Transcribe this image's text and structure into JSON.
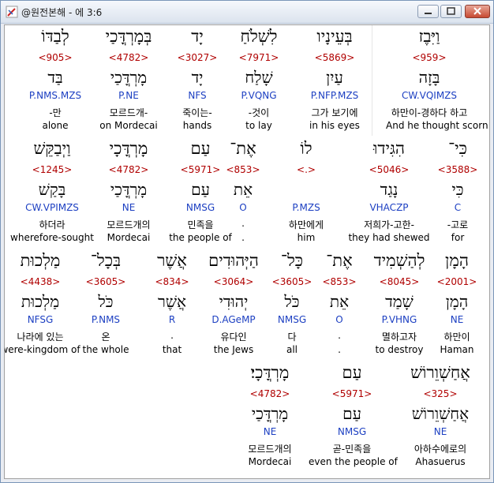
{
  "window": {
    "title": "@원전본해 - 에 3:6"
  },
  "rows": [
    [
      {
        "heb": "וַיִּבֶז",
        "strong": "<959>",
        "lemma": "בָּזָה",
        "morph": "CW.VQIMZS",
        "kor": "하만이-경하다 하고",
        "eng": "And he thought scorn",
        "selected": true
      },
      {
        "heb": "בְּעֵינָיו",
        "strong": "<5869>",
        "lemma": "עַיִן",
        "morph": "P.NFP.MZS",
        "kor": "그가 보기에",
        "eng": "in his eyes"
      },
      {
        "heb": "לִשְׁלֹחַ",
        "strong": "<7971>",
        "lemma": "שָׁלַח",
        "morph": "P.VQNG",
        "kor": "-것이",
        "eng": "to lay"
      },
      {
        "heb": "יָד",
        "strong": "<3027>",
        "lemma": "יָד",
        "morph": "NFS",
        "kor": "죽이는-",
        "eng": "hands"
      },
      {
        "heb": "בְּמָרְדֳּכַי",
        "strong": "<4782>",
        "lemma": "מָרְדֳּכַי",
        "morph": "P.NE",
        "kor": "모르드개-",
        "eng": "on Mordecai"
      },
      {
        "heb": "לְבַדּוֹ",
        "strong": "<905>",
        "lemma": "בַּד",
        "morph": "P.NMS.MZS",
        "kor": "-만",
        "eng": "alone"
      }
    ],
    [
      {
        "heb": "כִּי־",
        "strong": "<3588>",
        "lemma": "כִּי",
        "morph": "C",
        "kor": "-고로",
        "eng": "for"
      },
      {
        "heb": "הִגִּידוּ",
        "strong": "<5046>",
        "lemma": "נָגַד",
        "morph": "VHACZP",
        "kor": "저희가-고한-",
        "eng": "they had shewed"
      },
      {
        "heb": "לוֹ",
        "strong": "<.>",
        "lemma": "",
        "morph": "P.MZS",
        "kor": "하만에게",
        "eng": "him"
      },
      {
        "heb": "אֶת־",
        "strong": "<853>",
        "lemma": "אֵת",
        "morph": "O",
        "kor": ".",
        "eng": "."
      },
      {
        "heb": "עַם",
        "strong": "<5971>",
        "lemma": "עַם",
        "morph": "NMSG",
        "kor": "민족을",
        "eng": "the people of"
      },
      {
        "heb": "מָרְדֳּכָי",
        "strong": "<4782>",
        "lemma": "מָרְדֳּכַי",
        "morph": "NE",
        "kor": "모르드개의",
        "eng": "Mordecai"
      },
      {
        "heb": "וַיְבַקֵּשׁ",
        "strong": "<1245>",
        "lemma": "בָּקַשׁ",
        "morph": "CW.VPIMZS",
        "kor": "하더라",
        "eng": "wherefore-sought"
      }
    ],
    [
      {
        "heb": "הָמָן",
        "strong": "<2001>",
        "lemma": "הָמָן",
        "morph": "NE",
        "kor": "하만이",
        "eng": "Haman"
      },
      {
        "heb": "לְהַשְׁמִיד",
        "strong": "<8045>",
        "lemma": "שָׁמַד",
        "morph": "P.VHNG",
        "kor": "멸하고자",
        "eng": "to destroy"
      },
      {
        "heb": "אֶת־",
        "strong": "<853>",
        "lemma": "אֵת",
        "morph": "O",
        "kor": ".",
        "eng": "."
      },
      {
        "heb": "כָּל־",
        "strong": "<3605>",
        "lemma": "כֹּל",
        "morph": "NMSG",
        "kor": "다",
        "eng": "all"
      },
      {
        "heb": "הַיְּהוּדִים",
        "strong": "<3064>",
        "lemma": "יְהוּדִי",
        "morph": "D.AGeMP",
        "kor": "유다인",
        "eng": "the Jews"
      },
      {
        "heb": "אֲשֶׁר",
        "strong": "<834>",
        "lemma": "אֲשֶׁר",
        "morph": "R",
        "kor": ".",
        "eng": "that"
      },
      {
        "heb": "בְּכָל־",
        "strong": "<3605>",
        "lemma": "כֹּל",
        "morph": "P.NMS",
        "kor": "온",
        "eng": "the whole"
      },
      {
        "heb": "מַלְכוּת",
        "strong": "<4438>",
        "lemma": "מַלְכוּת",
        "morph": "NFSG",
        "kor": "나라에 있는",
        "eng": "were-kingdom of"
      }
    ],
    [
      {
        "heb": "אֲחַשְׁוֵרוֹשׁ",
        "strong": "<325>",
        "lemma": "אֲחַשְׁוֵרוֹשׁ",
        "morph": "NE",
        "kor": "아하수에로의",
        "eng": "Ahasuerus"
      },
      {
        "heb": "עַם",
        "strong": "<5971>",
        "lemma": "עַם",
        "morph": "NMSG",
        "kor": "곧-민족을",
        "eng": "even the people of"
      },
      {
        "heb": "מָרְדֳּכָי׃",
        "strong": "<4782>",
        "lemma": "מָרְדֳּכַי",
        "morph": "NE",
        "kor": "모르드개의",
        "eng": "Mordecai"
      }
    ]
  ]
}
